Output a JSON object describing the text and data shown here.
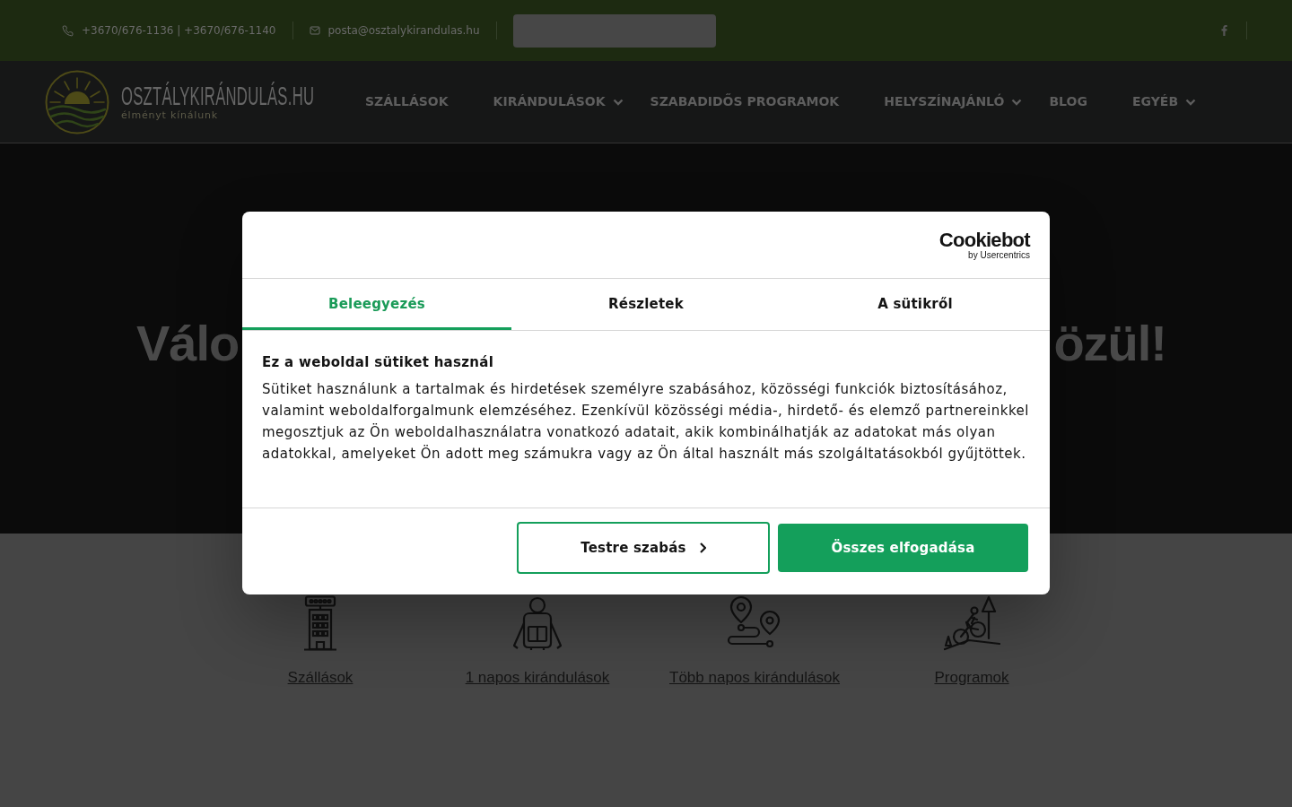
{
  "top_bar": {
    "phone": "+3670/676-1136 | +3670/676-1140",
    "email": "posta@osztalykirandulas.hu"
  },
  "header": {
    "logo_title": "OSZTÁLYKIRÁNDULÁS.HU",
    "logo_tagline": "élményt kínálunk",
    "nav": [
      {
        "label": "SZÁLLÁSOK",
        "dropdown": false
      },
      {
        "label": "KIRÁNDULÁSOK",
        "dropdown": true
      },
      {
        "label": "SZABADIDŐS PROGRAMOK",
        "dropdown": false
      },
      {
        "label": "HELYSZÍNAJÁNLÓ",
        "dropdown": true
      },
      {
        "label": "BLOG",
        "dropdown": false
      },
      {
        "label": "EGYÉB",
        "dropdown": true
      }
    ]
  },
  "hero": {
    "heading_visible_parts": [
      "Válo",
      "özül!"
    ]
  },
  "categories": [
    {
      "label": "Szállások"
    },
    {
      "label": "1 napos kirándulások"
    },
    {
      "label": "Több napos kirándulások"
    },
    {
      "label": "Programok"
    }
  ],
  "cookie_dialog": {
    "brand": "Cookiebot",
    "brand_byline": "by Usercentrics",
    "tabs": [
      {
        "label": "Beleegyezés",
        "selected": true
      },
      {
        "label": "Részletek",
        "selected": false
      },
      {
        "label": "A sütikről",
        "selected": false
      }
    ],
    "title": "Ez a weboldal sütiket használ",
    "text": "Sütiket használunk a tartalmak és hirdetések személyre szabásához, közösségi funkciók biztosításához, valamint weboldalforgalmunk elemzéséhez. Ezenkívül közösségi média-, hirdető- és elemző partnereinkkel megosztjuk az Ön weboldalhasználatra vonatkozó adatait, akik kombinálhatják az adatokat más olyan adatokkal, amelyeket Ön adott meg számukra vagy az Ön által használt más szolgáltatásokból gyűjtöttek.",
    "buttons": [
      {
        "label": "Testre szabás",
        "kind": "secondary"
      },
      {
        "label": "Összes elfogadása",
        "kind": "primary"
      }
    ]
  }
}
